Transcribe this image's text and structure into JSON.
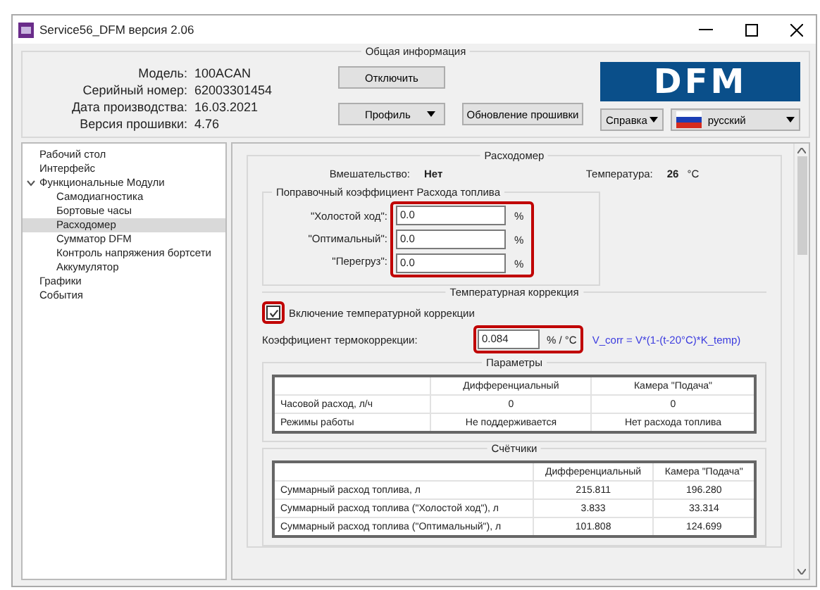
{
  "window": {
    "title": "Service56_DFM версия 2.06"
  },
  "general_info": {
    "title": "Общая информация",
    "fields": [
      {
        "label": "Модель:",
        "value": "100ACAN"
      },
      {
        "label": "Серийный номер:",
        "value": "62003301454"
      },
      {
        "label": "Дата производства:",
        "value": "16.03.2021"
      },
      {
        "label": "Версия прошивки:",
        "value": "4.76"
      }
    ],
    "disconnect": "Отключить",
    "profile": "Профиль",
    "firmware_update": "Обновление прошивки",
    "logo": "DFM",
    "help": "Справка",
    "language": "русский"
  },
  "sidebar": {
    "items": [
      {
        "label": "Рабочий стол",
        "selected": false
      },
      {
        "label": "Интерфейс",
        "selected": false
      },
      {
        "label": "Функциональные Модули",
        "selected": false,
        "expanded": true,
        "children": [
          {
            "label": "Самодиагностика",
            "selected": false
          },
          {
            "label": "Бортовые часы",
            "selected": false
          },
          {
            "label": "Расходомер",
            "selected": true
          },
          {
            "label": "Сумматор DFM",
            "selected": false
          },
          {
            "label": "Контроль напряжения бортсети",
            "selected": false
          },
          {
            "label": "Аккумулятор",
            "selected": false
          }
        ]
      },
      {
        "label": "Графики",
        "selected": false
      },
      {
        "label": "События",
        "selected": false
      }
    ]
  },
  "flowmeter": {
    "title": "Расходомер",
    "interference_label": "Вмешательство:",
    "interference_value": "Нет",
    "temperature_label": "Температура:",
    "temperature_value": "26",
    "temperature_unit": "°C",
    "correction": {
      "title": "Поправочный коэффициент Расхода топлива",
      "rows": [
        {
          "label": "\"Холостой ход\":",
          "value": "0.0",
          "unit": "%"
        },
        {
          "label": "\"Оптимальный\":",
          "value": "0.0",
          "unit": "%"
        },
        {
          "label": "\"Перегруз\":",
          "value": "0.0",
          "unit": "%"
        }
      ]
    },
    "temp_correction": {
      "title": "Температурная коррекция",
      "checkbox_label": "Включение температурной коррекции",
      "checked": true,
      "coef_label": "Коэффициент термокоррекции:",
      "coef_value": "0.084",
      "coef_unit": "% / °C",
      "formula": "V_corr = V*(1-(t-20°C)*K_temp)"
    },
    "parameters": {
      "title": "Параметры",
      "columns": [
        "Дифференциальный",
        "Камера \"Подача\""
      ],
      "rows": [
        {
          "label": "Часовой расход, л/ч",
          "cells": [
            "0",
            "0"
          ]
        },
        {
          "label": "Режимы работы",
          "cells": [
            "Не поддерживается",
            "Нет расхода топлива"
          ]
        }
      ]
    },
    "counters": {
      "title": "Счётчики",
      "columns": [
        "Дифференциальный",
        "Камера \"Подача\""
      ],
      "rows": [
        {
          "label": "Суммарный расход топлива, л",
          "cells": [
            "215.811",
            "196.280"
          ]
        },
        {
          "label": "Суммарный расход топлива (\"Холостой ход\"), л",
          "cells": [
            "3.833",
            "33.314"
          ]
        },
        {
          "label": "Суммарный расход топлива (\"Оптимальный\"), л",
          "cells": [
            "101.808",
            "124.699"
          ]
        }
      ]
    }
  }
}
